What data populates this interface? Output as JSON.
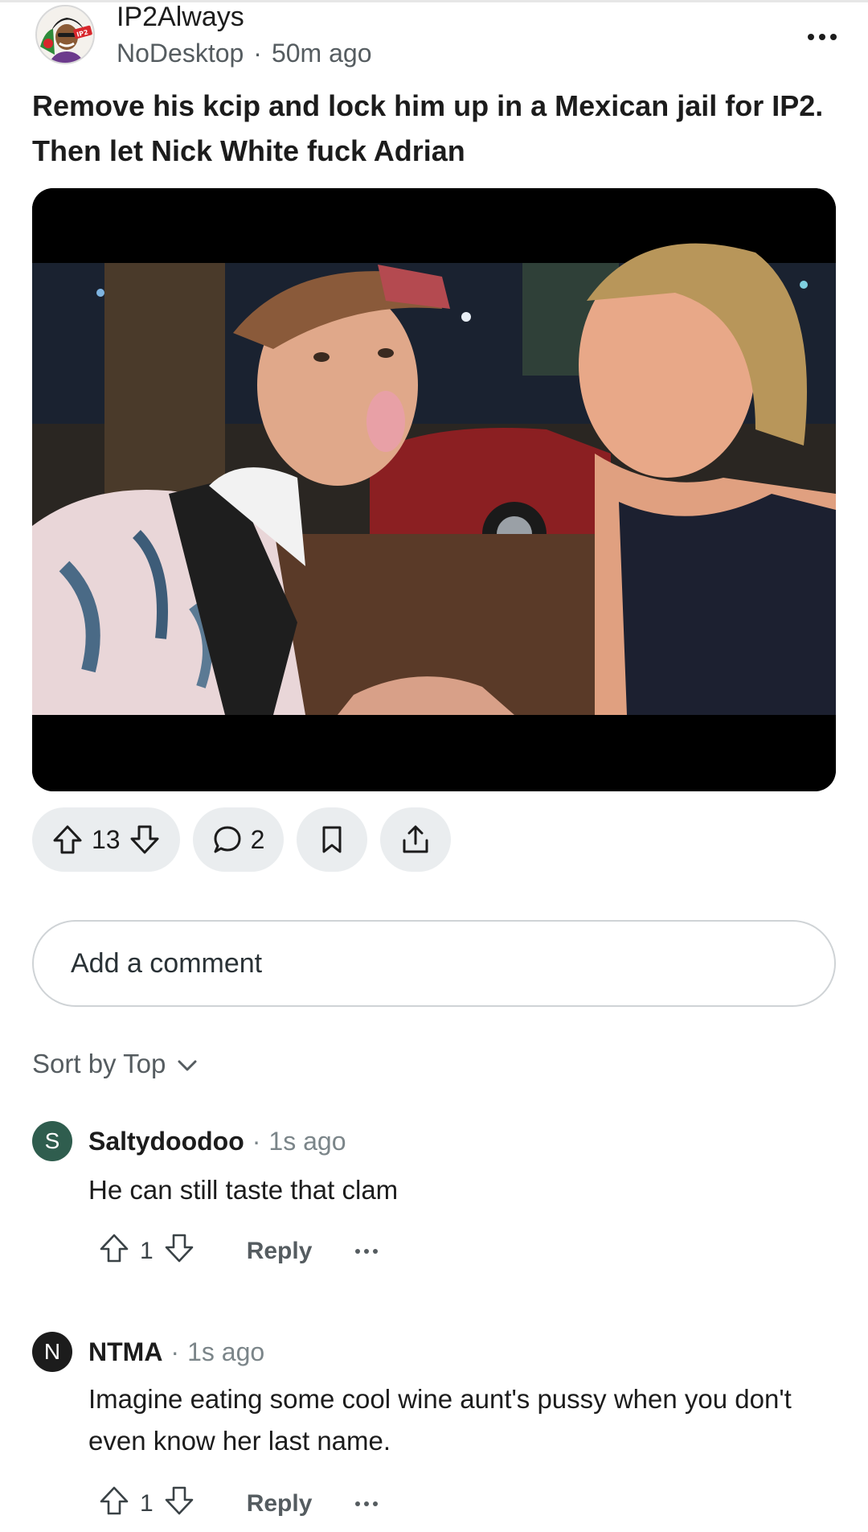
{
  "post": {
    "author": "IP2Always",
    "community": "NoDesktop",
    "time": "50m ago",
    "title_line1": "Remove his kcip and lock him up in a Mexican jail for IP2.",
    "title_line2": "Then let Nick White fuck Adrian",
    "avatar_badge": "IP2"
  },
  "actions": {
    "votes": "13",
    "comments": "2"
  },
  "comment_box": {
    "placeholder": "Add a comment"
  },
  "sort": {
    "label": "Sort by Top"
  },
  "comments": [
    {
      "initial": "S",
      "avatar_color": "#2f5d4e",
      "author": "Saltydoodoo",
      "time": "1s ago",
      "body_line1": "He can still taste that clam",
      "votes": "1",
      "reply_label": "Reply"
    },
    {
      "initial": "N",
      "avatar_color": "#1c1c1c",
      "author": "NTMA",
      "time": "1s ago",
      "body_line1": "Imagine eating some cool wine aunt's pussy when you don't",
      "body_line2": "even know her last name.",
      "votes": "1",
      "reply_label": "Reply"
    }
  ],
  "icons": [
    "more-icon",
    "upvote-icon",
    "downvote-icon",
    "comment-icon",
    "bookmark-icon",
    "share-icon",
    "chevron-down-icon"
  ],
  "colors": {
    "pill_bg": "#eaedef",
    "meta_text": "#555c60",
    "media_bg": "#000000"
  }
}
